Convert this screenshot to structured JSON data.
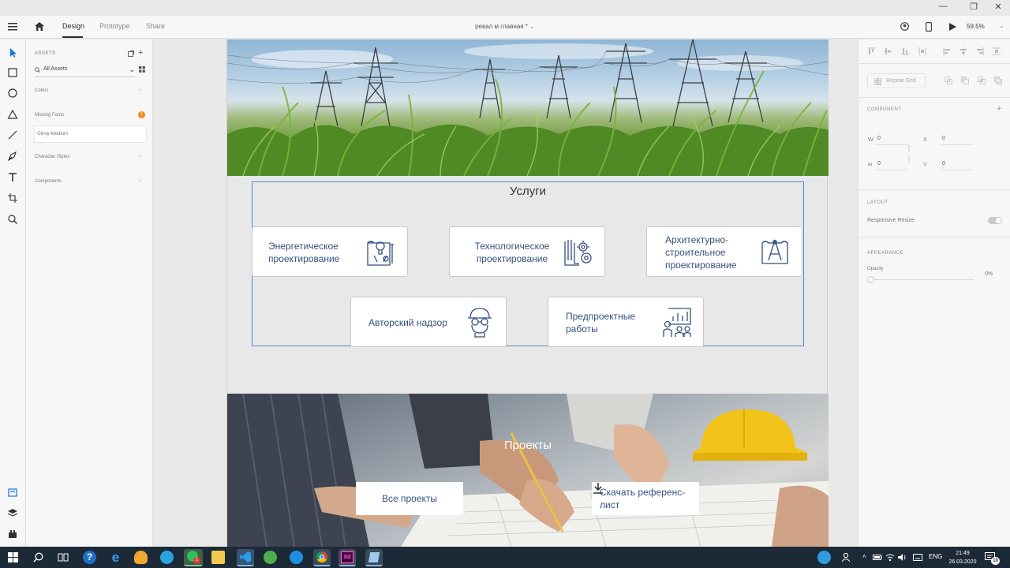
{
  "toolbar": {
    "tabs": [
      "Design",
      "Prototype",
      "Share"
    ],
    "doc_title": "ревал м главная *",
    "zoom": "59.5%"
  },
  "assets": {
    "heading": "ASSETS",
    "filter": "All Assets",
    "colors": "Colors",
    "missing_fonts": "Missing Fonts",
    "missing_font_name": "Gilroy-Medium",
    "missing_badge": "!",
    "character_styles": "Character Styles",
    "components": "Components"
  },
  "artboard": {
    "services_title": "Услуги",
    "services": [
      {
        "label": "Энергетическое проектирование",
        "icon": "power-design-icon"
      },
      {
        "label": "Технологическое проектирование",
        "icon": "gears-blueprint-icon"
      },
      {
        "label": "Архитектурно-строительное проектирование",
        "icon": "compass-blueprint-icon"
      },
      {
        "label": "Авторский надзор",
        "icon": "engineer-helmet-icon"
      },
      {
        "label": "Предпроектные работы",
        "icon": "presentation-chart-icon"
      }
    ],
    "projects_title": "Проекты",
    "all_projects": "Все проекты",
    "download_ref": "Скачать референс-лист"
  },
  "inspector": {
    "repeat_grid": "Repeat Grid",
    "component": "COMPONENT",
    "w_label": "W",
    "w_value": "0",
    "h_label": "H",
    "h_value": "0",
    "x_label": "X",
    "x_value": "0",
    "y_label": "Y",
    "y_value": "0",
    "layout": "LAYOUT",
    "responsive_resize": "Responsive Resize",
    "appearance": "APPEARANCE",
    "opacity": "Opacity",
    "opacity_value": "0%"
  },
  "taskbar": {
    "lang": "ENG",
    "time": "21:49",
    "date": "26.03.2020",
    "notif_count": "10",
    "whatsapp_badge": "1"
  },
  "colors": {
    "accent_text": "#33507e",
    "selection": "#4a8fd6",
    "taskbar": "#1c2a38"
  }
}
